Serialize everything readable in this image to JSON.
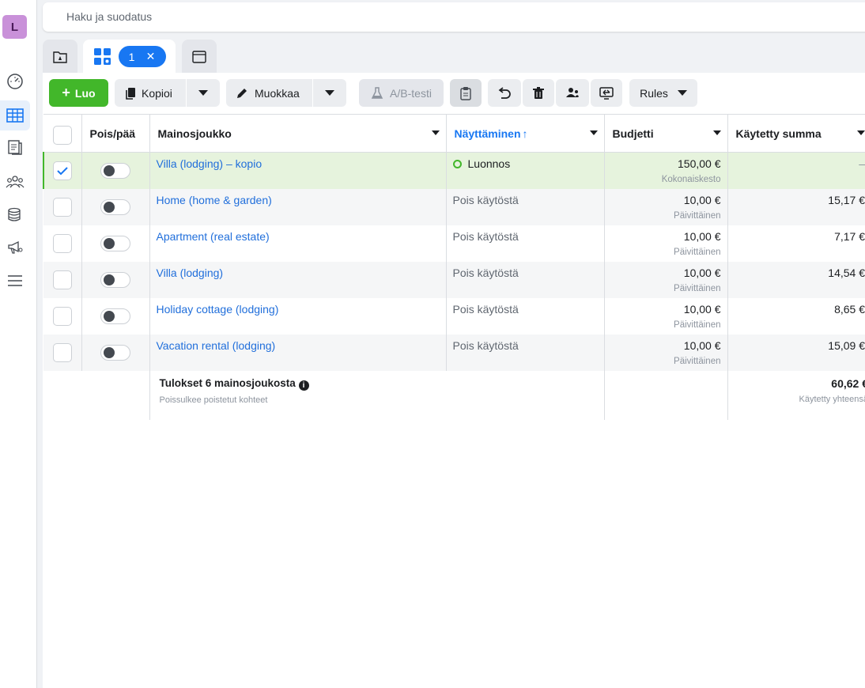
{
  "rail": {
    "logo": "L",
    "icons": [
      "speedometer-icon",
      "table-icon",
      "pages-icon",
      "audience-icon",
      "database-icon",
      "megaphone-icon",
      "menu-icon"
    ]
  },
  "search": {
    "placeholder": "Haku ja suodatus"
  },
  "tabs": {
    "selected_count": "1",
    "clear_symbol": "✕"
  },
  "toolbar": {
    "create": "Luo",
    "copy": "Kopioi",
    "edit": "Muokkaa",
    "ab_test": "A/B-testi",
    "rules": "Rules"
  },
  "table": {
    "headers": {
      "toggle": "Pois/pää",
      "name": "Mainosjoukko",
      "delivery": "Näyttäminen",
      "sort_arrow": "↑",
      "budget": "Budjetti",
      "spent": "Käytetty summa"
    },
    "rows": [
      {
        "name": "Villa (lodging) – kopio",
        "delivery": "Luonnos",
        "budget": "150,00 €",
        "budget_type": "Kokonaiskesto",
        "spent": "–",
        "selected": true
      },
      {
        "name": "Home (home & garden)",
        "delivery": "Pois käytöstä",
        "budget": "10,00 €",
        "budget_type": "Päivittäinen",
        "spent": "15,17 €",
        "selected": false
      },
      {
        "name": "Apartment (real estate)",
        "delivery": "Pois käytöstä",
        "budget": "10,00 €",
        "budget_type": "Päivittäinen",
        "spent": "7,17 €",
        "selected": false
      },
      {
        "name": "Villa (lodging)",
        "delivery": "Pois käytöstä",
        "budget": "10,00 €",
        "budget_type": "Päivittäinen",
        "spent": "14,54 €",
        "selected": false
      },
      {
        "name": "Holiday cottage (lodging)",
        "delivery": "Pois käytöstä",
        "budget": "10,00 €",
        "budget_type": "Päivittäinen",
        "spent": "8,65 €",
        "selected": false
      },
      {
        "name": "Vacation rental (lodging)",
        "delivery": "Pois käytöstä",
        "budget": "10,00 €",
        "budget_type": "Päivittäinen",
        "spent": "15,09 €",
        "selected": false
      }
    ],
    "footer": {
      "title": "Tulokset 6 mainosjoukosta",
      "subtitle": "Poissulkee poistetut kohteet",
      "total": "60,62 €",
      "total_label": "Käytetty yhteensä"
    }
  },
  "colors": {
    "accent": "#1877f2",
    "create": "#42b72a",
    "link": "#216fdb",
    "selected_row": "#e6f3dd"
  }
}
